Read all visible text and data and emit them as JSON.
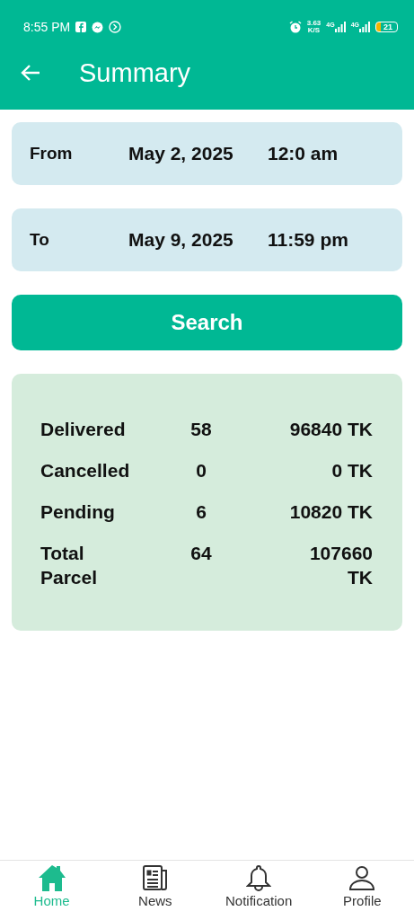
{
  "status_bar": {
    "time": "8:55 PM",
    "speed": "3.63",
    "speed_unit": "K/S",
    "network_1": "4G",
    "network_2": "4G",
    "battery": "21"
  },
  "app_bar": {
    "title": "Summary"
  },
  "range": [
    {
      "label": "From",
      "date": "May 2, 2025",
      "time": "12:0 am"
    },
    {
      "label": "To",
      "date": "May 9, 2025",
      "time": "11:59 pm"
    }
  ],
  "search_button": "Search",
  "summary": [
    {
      "label": "Delivered",
      "count": "58",
      "amount": "96840  TK"
    },
    {
      "label": "Cancelled",
      "count": "0",
      "amount": "0  TK"
    },
    {
      "label": "Pending",
      "count": "6",
      "amount": "10820  TK"
    },
    {
      "label": "Total Parcel",
      "count": "64",
      "amount": "107660 TK"
    }
  ],
  "nav": [
    {
      "label": "Home",
      "kind": "home",
      "selected": true
    },
    {
      "label": "News",
      "kind": "news",
      "selected": false
    },
    {
      "label": "Notification",
      "kind": "bell",
      "selected": false
    },
    {
      "label": "Profile",
      "kind": "person",
      "selected": false
    }
  ]
}
